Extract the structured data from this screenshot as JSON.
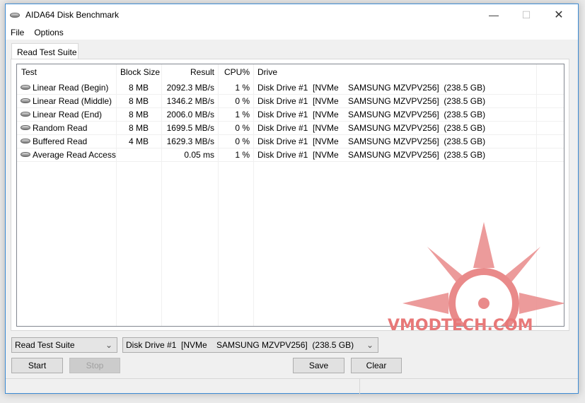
{
  "window": {
    "title": "AIDA64 Disk Benchmark"
  },
  "menu": [
    "File",
    "Options"
  ],
  "tab": "Read Test Suite",
  "columns": [
    "Test",
    "Block Size",
    "Result",
    "CPU%",
    "Drive"
  ],
  "rows": [
    {
      "test": "Linear Read (Begin)",
      "block": "8 MB",
      "result": "2092.3 MB/s",
      "cpu": "1 %",
      "drive": "Disk Drive #1  [NVMe    SAMSUNG MZVPV256]  (238.5 GB)"
    },
    {
      "test": "Linear Read (Middle)",
      "block": "8 MB",
      "result": "1346.2 MB/s",
      "cpu": "0 %",
      "drive": "Disk Drive #1  [NVMe    SAMSUNG MZVPV256]  (238.5 GB)"
    },
    {
      "test": "Linear Read (End)",
      "block": "8 MB",
      "result": "2006.0 MB/s",
      "cpu": "1 %",
      "drive": "Disk Drive #1  [NVMe    SAMSUNG MZVPV256]  (238.5 GB)"
    },
    {
      "test": "Random Read",
      "block": "8 MB",
      "result": "1699.5 MB/s",
      "cpu": "0 %",
      "drive": "Disk Drive #1  [NVMe    SAMSUNG MZVPV256]  (238.5 GB)"
    },
    {
      "test": "Buffered Read",
      "block": "4 MB",
      "result": "1629.3 MB/s",
      "cpu": "0 %",
      "drive": "Disk Drive #1  [NVMe    SAMSUNG MZVPV256]  (238.5 GB)"
    },
    {
      "test": "Average Read Access",
      "block": "",
      "result": "0.05 ms",
      "cpu": "1 %",
      "drive": "Disk Drive #1  [NVMe    SAMSUNG MZVPV256]  (238.5 GB)"
    }
  ],
  "controls": {
    "suite": "Read Test Suite",
    "drive": "Disk Drive #1  [NVMe    SAMSUNG MZVPV256]  (238.5 GB)",
    "start": "Start",
    "stop": "Stop",
    "save": "Save",
    "clear": "Clear"
  },
  "watermark": "VMODTECH.COM"
}
